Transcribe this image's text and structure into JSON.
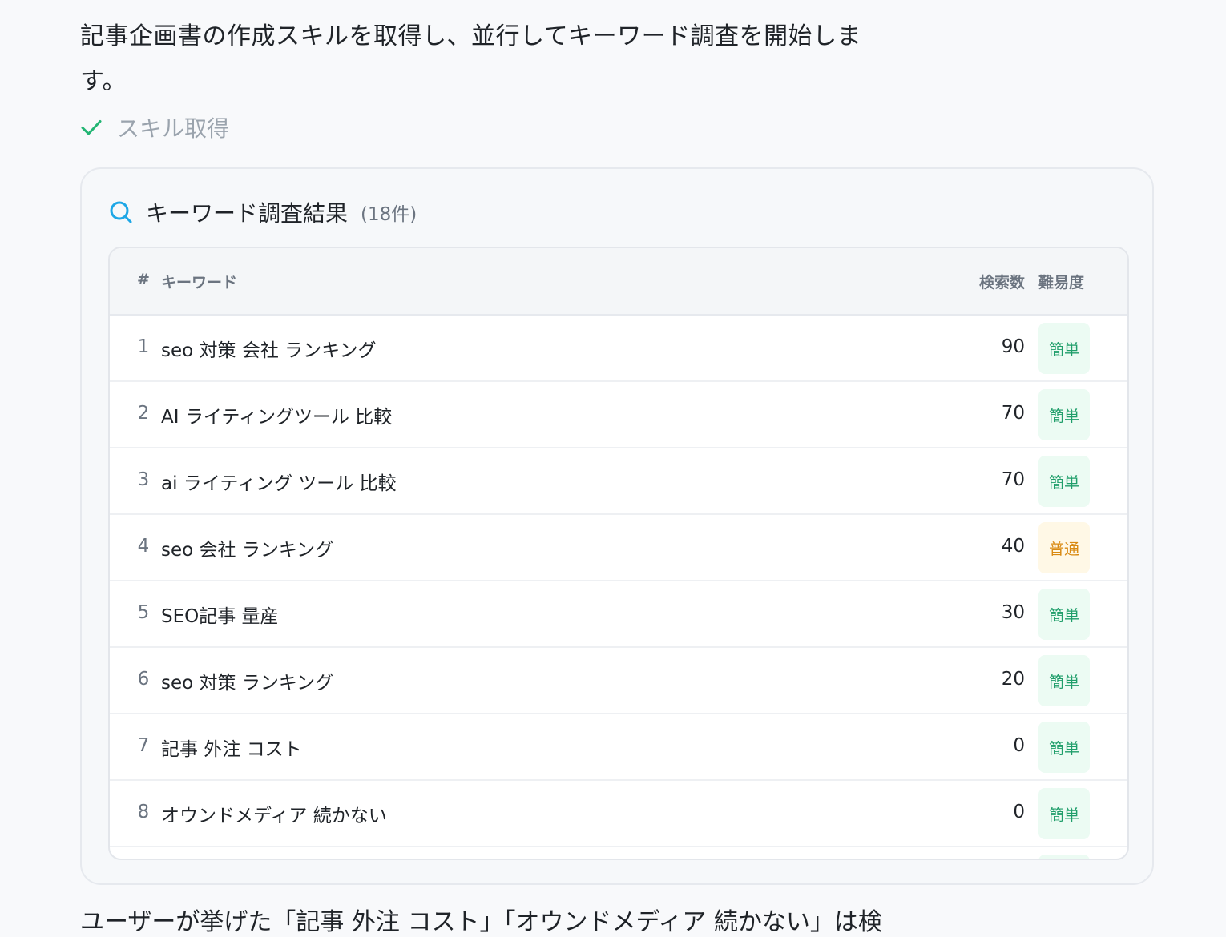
{
  "intro": {
    "line1": "記事企画書の作成スキルを取得し、並行してキーワード調査を開始しま",
    "line2": "す。"
  },
  "status": {
    "label": "スキル取得",
    "icon": "check-icon",
    "color": "#22b573"
  },
  "card": {
    "title": "キーワード調査結果",
    "count": "(18件)",
    "icon": "search-icon",
    "accent": "#1ea7e6"
  },
  "table": {
    "headers": {
      "num": "#",
      "keyword": "キーワード",
      "volume": "検索数",
      "difficulty": "難易度"
    },
    "rows": [
      {
        "num": "1",
        "keyword": "seo 対策 会社 ランキング",
        "volume": "90",
        "difficulty": "簡単",
        "level": "easy"
      },
      {
        "num": "2",
        "keyword": "AI ライティングツール 比較",
        "volume": "70",
        "difficulty": "簡単",
        "level": "easy"
      },
      {
        "num": "3",
        "keyword": "ai ライティング ツール 比較",
        "volume": "70",
        "difficulty": "簡単",
        "level": "easy"
      },
      {
        "num": "4",
        "keyword": "seo 会社 ランキング",
        "volume": "40",
        "difficulty": "普通",
        "level": "normal"
      },
      {
        "num": "5",
        "keyword": "SEO記事 量産",
        "volume": "30",
        "difficulty": "簡単",
        "level": "easy"
      },
      {
        "num": "6",
        "keyword": "seo 対策 ランキング",
        "volume": "20",
        "difficulty": "簡単",
        "level": "easy"
      },
      {
        "num": "7",
        "keyword": "記事 外注 コスト",
        "volume": "0",
        "difficulty": "簡単",
        "level": "easy"
      },
      {
        "num": "8",
        "keyword": "オウンドメディア 続かない",
        "volume": "0",
        "difficulty": "簡単",
        "level": "easy"
      }
    ]
  },
  "colors": {
    "easy_bg": "#ecfbf3",
    "easy_text": "#1f9e6a",
    "normal_bg": "#fff8e6",
    "normal_text": "#d98a12"
  },
  "bottom": {
    "text": "ユーザーが挙げた「記事 外注 コスト」「オウンドメディア 続かない」は検"
  }
}
